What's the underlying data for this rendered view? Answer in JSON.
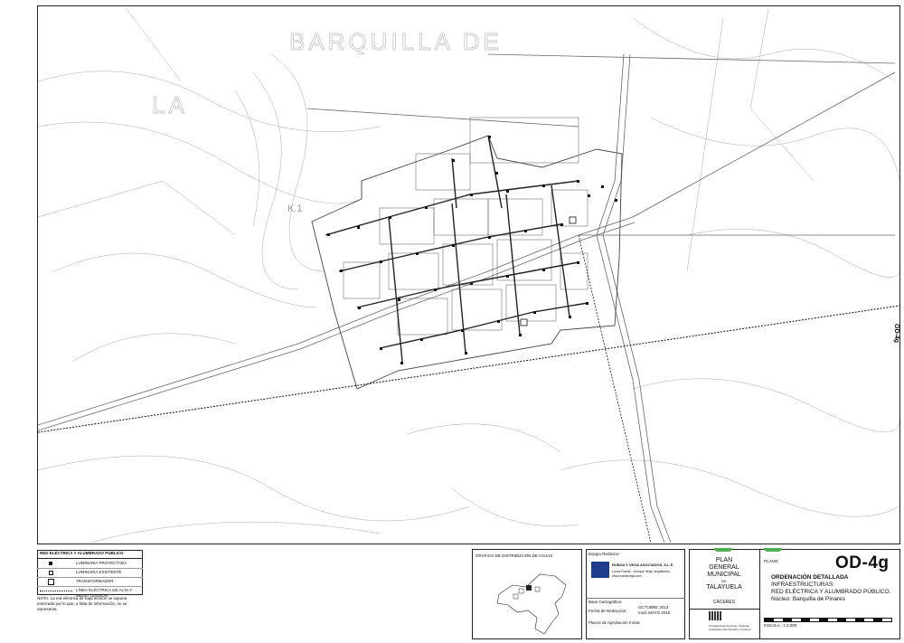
{
  "map": {
    "place_labels": [
      "BARQUILLA DE",
      "LA",
      "K.1"
    ],
    "side_code": "OD-4g"
  },
  "legend": {
    "title": "RED ELÉCTRICA Y ALUMBRADO PÚBLICO",
    "items": [
      {
        "symbol": "projected-luminaire",
        "label": "LUMINARIA PROYECTADA"
      },
      {
        "symbol": "existing-luminaire",
        "label": "LUMINARIA EXISTENTE"
      },
      {
        "symbol": "transformer",
        "label": "TRANSFORMADOR"
      },
      {
        "symbol": "high-voltage-line",
        "label": "LÍNEA ELÉCTRICA  DE ALTA Y MEDIA TENSIÓN"
      }
    ],
    "note": "NOTA: La red eléctrica de baja tensión se supone enterrada por lo que, a falta de información, no se representa."
  },
  "key_map": {
    "title": "GRÁFICO DE DISTRIBUCIÓN DE HOJAS"
  },
  "team": {
    "label": "Equipo Redactor:",
    "company": "RUEDA Y VEGA ASOCIADOS, S.L.P.",
    "line2": "Lucas Rueda · Enrique Vega, arquitectos",
    "line3": "www.ruedavega.com",
    "base_label": "Base Cartográfica:",
    "date_label": "Fecha de Redacción:",
    "date_value1": "OCTUBRE 2013",
    "date_value2": "mod. MAYO 2015",
    "approval_label": "Planos de Aprobación Inicial"
  },
  "title_block": {
    "plan_lines": [
      "PLAN",
      "GENERAL",
      "MUNICIPAL"
    ],
    "de": "DE",
    "town": "TALAYUELA",
    "province": "CÁCERES",
    "plano_label": "PLANO:",
    "plan_code": "OD-4g",
    "heading": "ORDENACIÓN DETALLADA",
    "subtitle1": "INFRAESTRUCTURAS:",
    "subtitle2": "RED ELÉCTRICA Y ALUMBRADO PÚBLICO.",
    "subtitle3": "Núcleo: Barquilla de Pinares",
    "scale_label": "ESCALA :  1:2.000",
    "authority": "Consejería de Fomento, Vivienda, Ordenación del Territorio y Turismo"
  }
}
